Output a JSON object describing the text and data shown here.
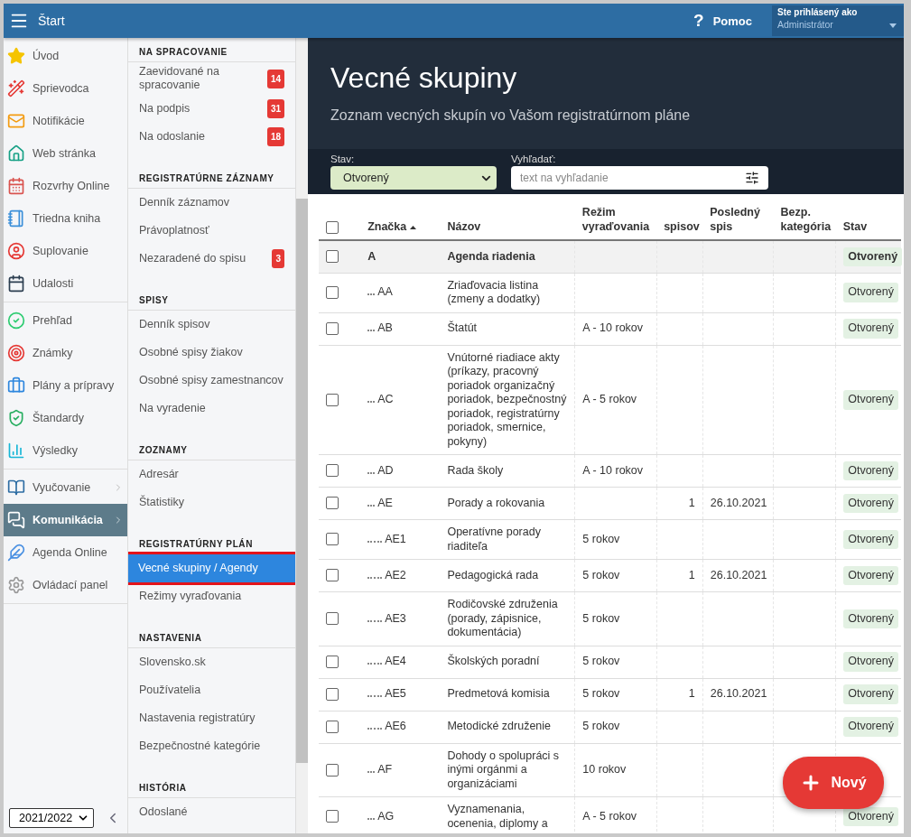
{
  "topbar": {
    "title": "Štart",
    "help_icon": "?",
    "help": "Pomoc",
    "user_label": "Ste prihlásený ako",
    "user": "Administrátor"
  },
  "sidebar": {
    "groups": [
      [
        {
          "label": "Úvod",
          "selected": false,
          "submenu": false
        },
        {
          "label": "Sprievodca",
          "selected": false,
          "submenu": false
        },
        {
          "label": "Notifikácie",
          "selected": false,
          "submenu": false
        },
        {
          "label": "Web stránka",
          "selected": false,
          "submenu": false
        },
        {
          "label": "Rozvrhy Online",
          "selected": false,
          "submenu": false
        },
        {
          "label": "Triedna kniha",
          "selected": false,
          "submenu": false
        },
        {
          "label": "Suplovanie",
          "selected": false,
          "submenu": false
        },
        {
          "label": "Udalosti",
          "selected": false,
          "submenu": false
        }
      ],
      [
        {
          "label": "Prehľad",
          "selected": false,
          "submenu": false
        },
        {
          "label": "Známky",
          "selected": false,
          "submenu": false
        },
        {
          "label": "Plány a prípravy",
          "selected": false,
          "submenu": false
        },
        {
          "label": "Štandardy",
          "selected": false,
          "submenu": false
        },
        {
          "label": "Výsledky",
          "selected": false,
          "submenu": false
        }
      ],
      [
        {
          "label": "Vyučovanie",
          "selected": false,
          "submenu": true
        },
        {
          "label": "Komunikácia",
          "selected": true,
          "submenu": true
        },
        {
          "label": "Agenda Online",
          "selected": false,
          "submenu": false
        },
        {
          "label": "Ovládací panel",
          "selected": false,
          "submenu": false
        }
      ]
    ],
    "year": "2021/2022"
  },
  "submenu": [
    {
      "title": "NA SPRACOVANIE",
      "items": [
        {
          "label": "Zaevidované na spracovanie",
          "badge": "14",
          "selected": false
        },
        {
          "label": "Na podpis",
          "badge": "31",
          "selected": false
        },
        {
          "label": "Na odoslanie",
          "badge": "18",
          "selected": false
        }
      ]
    },
    {
      "title": "REGISTRATÚRNE ZÁZNAMY",
      "items": [
        {
          "label": "Denník záznamov",
          "selected": false
        },
        {
          "label": "Právoplatnosť",
          "selected": false
        },
        {
          "label": "Nezaradené do spisu",
          "badge": "3",
          "selected": false
        }
      ]
    },
    {
      "title": "SPISY",
      "items": [
        {
          "label": "Denník spisov",
          "selected": false
        },
        {
          "label": "Osobné spisy žiakov",
          "selected": false
        },
        {
          "label": "Osobné spisy zamestnancov",
          "selected": false
        },
        {
          "label": "Na vyradenie",
          "selected": false
        }
      ]
    },
    {
      "title": "ZOZNAMY",
      "items": [
        {
          "label": "Adresár",
          "selected": false
        },
        {
          "label": "Štatistiky",
          "selected": false
        }
      ]
    },
    {
      "title": "REGISTRATÚRNY PLÁN",
      "items": [
        {
          "label": "Vecné skupiny / Agendy",
          "selected": true
        },
        {
          "label": "Režimy vyraďovania",
          "selected": false
        }
      ]
    },
    {
      "title": "NASTAVENIA",
      "items": [
        {
          "label": "Slovensko.sk",
          "selected": false
        },
        {
          "label": "Používatelia",
          "selected": false
        },
        {
          "label": "Nastavenia registratúry",
          "selected": false
        },
        {
          "label": "Bezpečnostné kategórie",
          "selected": false
        }
      ]
    },
    {
      "title": "HISTÓRIA",
      "items": [
        {
          "label": "Odoslané",
          "selected": false
        }
      ]
    }
  ],
  "page": {
    "title": "Vecné skupiny",
    "subtitle": "Zoznam vecných skupín vo Vašom registratúrnom pláne"
  },
  "filters": {
    "status_label": "Stav:",
    "status_value": "Otvorený",
    "search_label": "Vyhľadať:",
    "search_placeholder": "text na vyhľadanie"
  },
  "table": {
    "columns": [
      "Značka",
      "Názov",
      "Režim vyraďovania",
      "spisov",
      "Posledný spis",
      "Bezp. kategória",
      "Stav"
    ],
    "header_checked": false,
    "rows": [
      {
        "code": "A",
        "name": "Agenda riadenia",
        "status": "Otvorený",
        "checked": false,
        "children": [
          {
            "code": "AA",
            "name": "Zriaďovacia listina (zmeny a dodatky)",
            "status": "Otvorený",
            "checked": false
          },
          {
            "code": "AB",
            "name": "Štatút",
            "mode": "A - 10 rokov",
            "status": "Otvorený",
            "checked": false
          },
          {
            "code": "AC",
            "name": "Vnútorné riadiace akty (príkazy, pracovný poriadok organizačný poriadok, bezpečnostný poriadok, registratúrny poriadok, smernice, pokyny)",
            "mode": "A - 5 rokov",
            "status": "Otvorený",
            "checked": false
          },
          {
            "code": "AD",
            "name": "Rada školy",
            "mode": "A - 10 rokov",
            "status": "Otvorený",
            "checked": false
          },
          {
            "code": "AE",
            "name": "Porady a rokovania",
            "files": "1",
            "last": "26.10.2021",
            "status": "Otvorený",
            "checked": false,
            "children": [
              {
                "code": "AE1",
                "name": "Operatívne porady riaditeľa",
                "mode": "5 rokov",
                "status": "Otvorený",
                "checked": false
              },
              {
                "code": "AE2",
                "name": "Pedagogická rada",
                "mode": "5 rokov",
                "files": "1",
                "last": "26.10.2021",
                "status": "Otvorený",
                "checked": false
              },
              {
                "code": "AE3",
                "name": "Rodičovské združenia (porady, zápisnice, dokumentácia)",
                "mode": "5 rokov",
                "status": "Otvorený",
                "checked": false
              },
              {
                "code": "AE4",
                "name": "Školských poradní",
                "mode": "5 rokov",
                "status": "Otvorený",
                "checked": false
              },
              {
                "code": "AE5",
                "name": "Predmetová komisia",
                "mode": "5 rokov",
                "files": "1",
                "last": "26.10.2021",
                "status": "Otvorený",
                "checked": false
              },
              {
                "code": "AE6",
                "name": "Metodické združenie",
                "mode": "5 rokov",
                "status": "Otvorený",
                "checked": false
              }
            ]
          },
          {
            "code": "AF",
            "name": "Dohody o spolupráci s inými orgánmi a organizáciami",
            "mode": "10 rokov",
            "checked": false
          },
          {
            "code": "AG",
            "name": "Vyznamenania, ocenenia, diplomy a",
            "mode": "A - 5 rokov",
            "status": "Otvorený",
            "checked": false
          }
        ]
      }
    ]
  },
  "new_button": "Nový"
}
